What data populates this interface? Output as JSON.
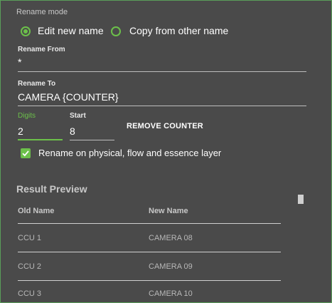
{
  "rename_mode": {
    "title": "Rename mode",
    "options": [
      {
        "label": "Edit new name",
        "selected": true
      },
      {
        "label": "Copy from other name",
        "selected": false
      }
    ]
  },
  "rename_from": {
    "label": "Rename From",
    "value": "*"
  },
  "rename_to": {
    "label": "Rename To",
    "value": "CAMERA {COUNTER}"
  },
  "counter": {
    "digits_label": "Digits",
    "digits_value": "2",
    "start_label": "Start",
    "start_value": "8",
    "remove_button": "REMOVE COUNTER"
  },
  "layers_checkbox": {
    "label": "Rename on physical, flow and essence layer",
    "checked": true
  },
  "result_preview": {
    "title": "Result Preview",
    "columns": [
      "Old Name",
      "New Name"
    ],
    "rows": [
      {
        "old": "CCU 1",
        "new": "CAMERA 08"
      },
      {
        "old": "CCU 2",
        "new": "CAMERA 09"
      },
      {
        "old": "CCU 3",
        "new": "CAMERA 10"
      }
    ]
  },
  "colors": {
    "accent": "#6cc04a",
    "background": "#4a4a4a"
  }
}
